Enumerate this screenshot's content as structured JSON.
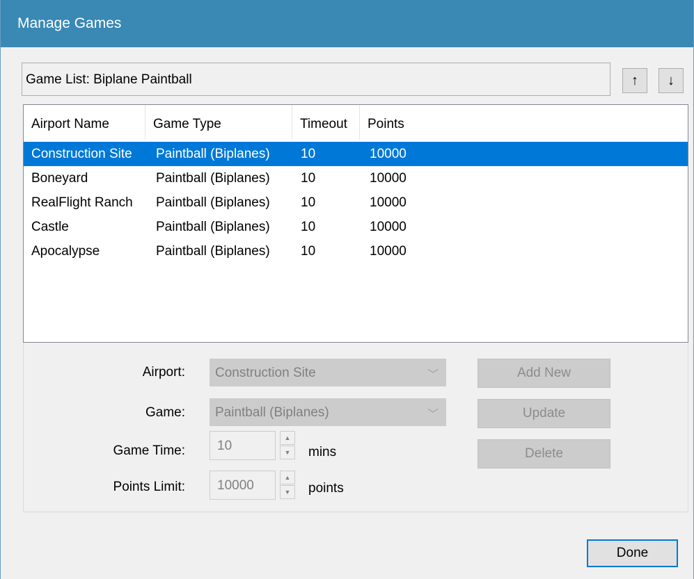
{
  "window": {
    "title": "Manage Games"
  },
  "game_list": {
    "label": "Game List: Biplane Paintball",
    "up_icon": "arrow-up-icon",
    "down_icon": "arrow-down-icon"
  },
  "table": {
    "columns": [
      "Airport Name",
      "Game Type",
      "Timeout",
      "Points"
    ],
    "rows": [
      {
        "airport": "Construction Site",
        "type": "Paintball (Biplanes)",
        "timeout": "10",
        "points": "10000",
        "selected": true
      },
      {
        "airport": "Boneyard",
        "type": "Paintball (Biplanes)",
        "timeout": "10",
        "points": "10000",
        "selected": false
      },
      {
        "airport": "RealFlight Ranch",
        "type": "Paintball (Biplanes)",
        "timeout": "10",
        "points": "10000",
        "selected": false
      },
      {
        "airport": "Castle",
        "type": "Paintball (Biplanes)",
        "timeout": "10",
        "points": "10000",
        "selected": false
      },
      {
        "airport": "Apocalypse",
        "type": "Paintball (Biplanes)",
        "timeout": "10",
        "points": "10000",
        "selected": false
      }
    ]
  },
  "form": {
    "airport_label": "Airport:",
    "airport_value": "Construction Site",
    "game_label": "Game:",
    "game_value": "Paintball (Biplanes)",
    "game_time_label": "Game Time:",
    "game_time_value": "10",
    "game_time_unit": "mins",
    "points_label": "Points Limit:",
    "points_value": "10000",
    "points_unit": "points"
  },
  "actions": {
    "add_new": "Add New",
    "update": "Update",
    "delete": "Delete",
    "done": "Done"
  },
  "colors": {
    "titlebar": "#3a88b4",
    "selection": "#0078d7"
  }
}
